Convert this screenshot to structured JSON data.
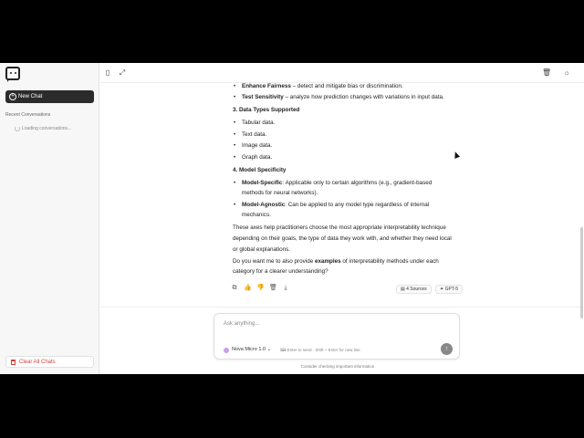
{
  "sidebar": {
    "new_chat_label": "New Chat",
    "recent_label": "Recent Conversations",
    "loading_label": "Loading conversations...",
    "clear_all_label": "Clear All Chats"
  },
  "topbar": {
    "sidebar_toggle_icon": "sidebar-icon",
    "expand_icon": "expand-icon",
    "trash_icon": "trash-icon",
    "theme_icon": "sun-icon"
  },
  "message": {
    "lines": [
      {
        "kind": "li",
        "bold": "Enhance Fairness",
        "text": " – detect and mitigate bias or discrimination."
      },
      {
        "kind": "li",
        "bold": "Test Sensitivity",
        "text": " – analyze how prediction changes with variations in input data."
      },
      {
        "kind": "h",
        "text": "3. Data Types Supported"
      },
      {
        "kind": "li",
        "text": "Tabular data."
      },
      {
        "kind": "li",
        "text": "Text data."
      },
      {
        "kind": "li",
        "text": "Image data."
      },
      {
        "kind": "li",
        "text": "Graph data."
      },
      {
        "kind": "h",
        "text": "4. Model Specificity"
      },
      {
        "kind": "li",
        "bold": "Model-Specific",
        "text": ": Applicable only to certain algorithms (e.g., gradient-based"
      },
      {
        "kind": "li-cont",
        "text": "methods for neural networks)."
      },
      {
        "kind": "li",
        "bold": "Model-Agnostic",
        "text": ": Can be applied to any model type regardless of internal"
      },
      {
        "kind": "li-cont",
        "text": "mechanics."
      },
      {
        "kind": "p",
        "text": "These axes help practitioners choose the most appropriate interpretability technique"
      },
      {
        "kind": "p",
        "text": "depending on their goals, the type of data they work with, and whether they need local"
      },
      {
        "kind": "p",
        "text": "or global explanations."
      },
      {
        "kind": "p",
        "pre": "Do you want me to also provide ",
        "bold": "examples",
        "text": " of interpretability methods under each"
      },
      {
        "kind": "p",
        "text": "category for a clearer understanding?"
      }
    ]
  },
  "actions": {
    "copy_icon": "copy-icon",
    "like_icon": "thumbs-up-icon",
    "dislike_icon": "thumbs-down-icon",
    "delete_icon": "trash-icon",
    "download_icon": "download-icon",
    "sources_label": "4 Sources",
    "model_badge": "GPT-5"
  },
  "composer": {
    "placeholder": "Ask anything...",
    "model_label": "Nova Micro 1.0",
    "hint": "Enter to send · Shift + Enter for new line"
  },
  "footer_text": "Consider checking important information"
}
